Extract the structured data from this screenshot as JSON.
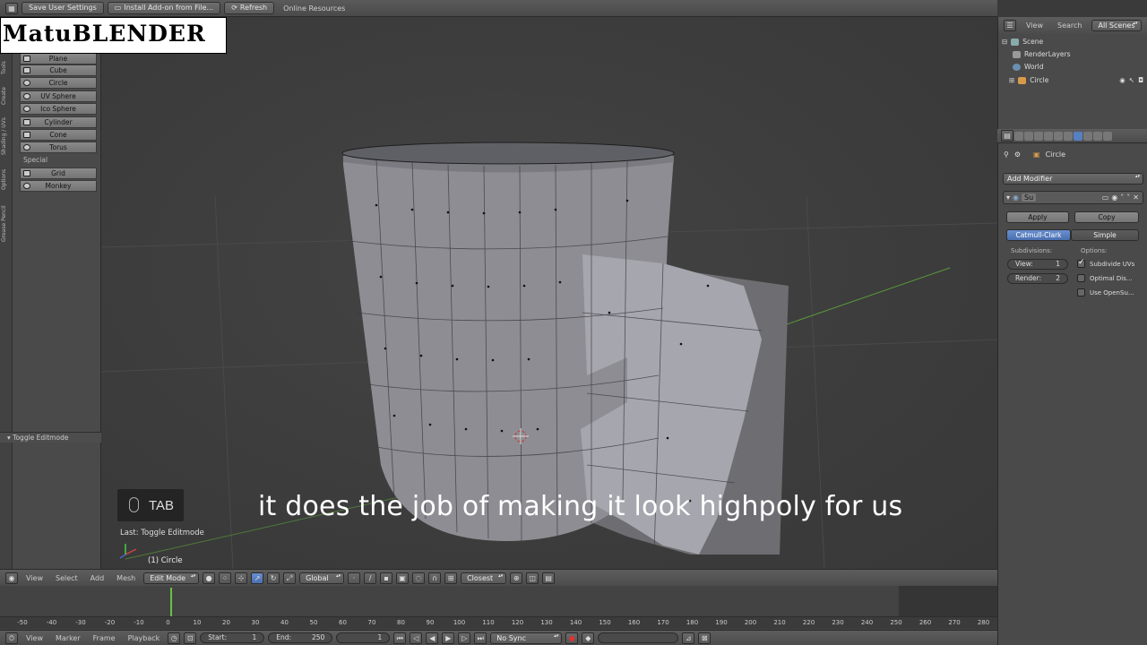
{
  "topbar": {
    "save_settings": "Save User Settings",
    "install_addon": "Install Add-on from File...",
    "refresh": "Refresh",
    "online_resources": "Online Resources"
  },
  "watermark": "MatuBLENDER",
  "toolshelf": {
    "tabs": [
      "Tools",
      "Create",
      "Shading / UVs",
      "Options",
      "Grease Pencil"
    ],
    "primitives": [
      "Plane",
      "Cube",
      "Circle",
      "UV Sphere",
      "Ico Sphere",
      "Cylinder",
      "Cone",
      "Torus"
    ],
    "special_label": "Special",
    "special": [
      "Grid",
      "Monkey"
    ],
    "operator_panel": "Toggle Editmode"
  },
  "viewport": {
    "key_label": "TAB",
    "last_op": "Last: Toggle Editmode",
    "object_name": "(1) Circle",
    "subtitle": "it does the job of making it look highpoly for us"
  },
  "view_header": {
    "menus": [
      "View",
      "Select",
      "Add",
      "Mesh"
    ],
    "mode": "Edit Mode",
    "orientation": "Global",
    "snap": "Closest"
  },
  "timeline": {
    "ticks": [
      "-50",
      "-40",
      "-30",
      "-20",
      "-10",
      "0",
      "10",
      "20",
      "30",
      "40",
      "50",
      "60",
      "70",
      "80",
      "90",
      "100",
      "110",
      "120",
      "130",
      "140",
      "150",
      "160",
      "170",
      "180",
      "190",
      "200",
      "210",
      "220",
      "230",
      "240",
      "250",
      "260",
      "270",
      "280"
    ],
    "menus": [
      "View",
      "Marker",
      "Frame",
      "Playback"
    ],
    "start_label": "Start:",
    "start_value": "1",
    "end_label": "End:",
    "end_value": "250",
    "current_frame": "1",
    "sync": "No Sync"
  },
  "outliner": {
    "view": "View",
    "search": "Search",
    "scope": "All Scenes",
    "items": [
      "Scene",
      "RenderLayers",
      "World",
      "Circle"
    ]
  },
  "properties": {
    "context": "Circle",
    "add_modifier": "Add Modifier",
    "modifier_short": "Su",
    "apply": "Apply",
    "copy": "Copy",
    "type_catmull": "Catmull-Clark",
    "type_simple": "Simple",
    "subdivisions_label": "Subdivisions:",
    "options_label": "Options:",
    "view_label": "View:",
    "view_value": "1",
    "render_label": "Render:",
    "render_value": "2",
    "opt_subdivide_uvs": "Subdivide UVs",
    "opt_optimal": "Optimal Dis...",
    "opt_opensubdiv": "Use OpenSu..."
  },
  "colors": {
    "accent": "#5680c2",
    "playhead": "#6ac04a"
  }
}
